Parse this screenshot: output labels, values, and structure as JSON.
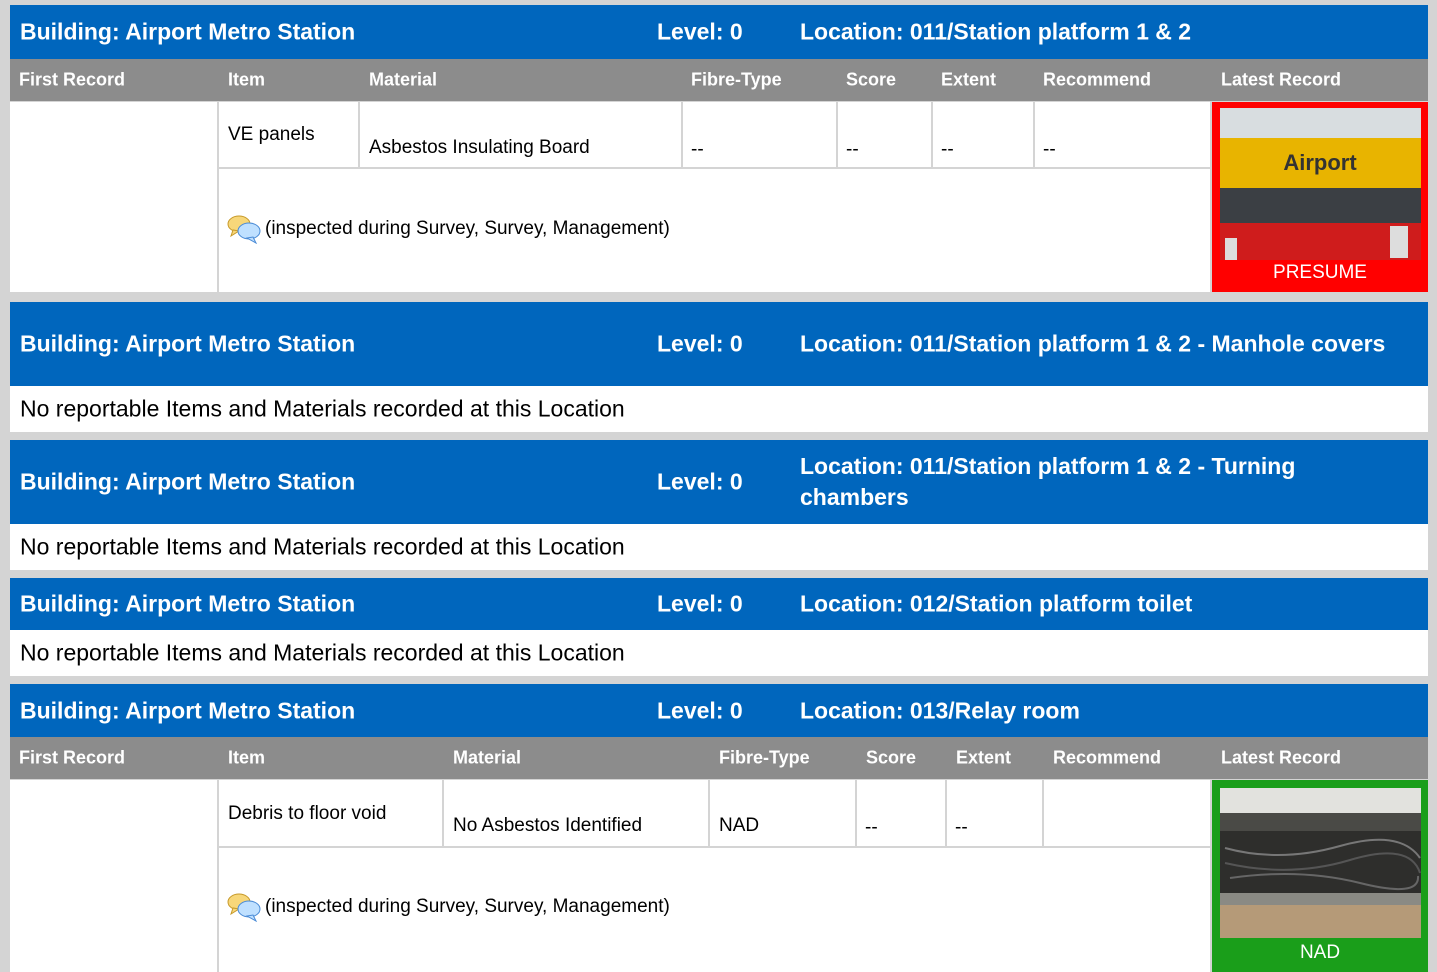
{
  "sections": [
    {
      "building": "Building: Airport Metro Station",
      "level": "Level: 0",
      "location": "Location: 011/Station platform 1 & 2"
    },
    {
      "building": "Building: Airport Metro Station",
      "level": "Level: 0",
      "location": "Location: 011/Station platform 1 & 2 - Manhole covers",
      "message": "No reportable Items and Materials recorded at this Location"
    },
    {
      "building": "Building: Airport Metro Station",
      "level": "Level: 0",
      "location": "Location: 011/Station platform 1 & 2 - Turning chambers",
      "message": "No reportable Items and Materials recorded at this Location"
    },
    {
      "building": "Building: Airport Metro Station",
      "level": "Level: 0",
      "location": "Location: 012/Station platform toilet",
      "message": "No reportable Items and Materials recorded at this Location"
    },
    {
      "building": "Building: Airport Metro Station",
      "level": "Level: 0",
      "location": "Location: 013/Relay room"
    }
  ],
  "columns": [
    "First Record",
    "Item",
    "Material",
    "Fibre-Type",
    "Score",
    "Extent",
    "Recommend",
    "Latest Record"
  ],
  "records": [
    {
      "item": "VE panels",
      "material": "Asbestos Insulating Board",
      "fibre_type": "--",
      "score": "--",
      "extent": "--",
      "recommend": "--",
      "note": "(inspected during Survey, Survey, Management)",
      "status": "PRESUME",
      "status_color": "#ff0000",
      "photo_sign_text": "Airport"
    },
    {
      "item": "Debris to floor void",
      "material": "No Asbestos Identified",
      "fibre_type": "NAD",
      "score": "--",
      "extent": "--",
      "recommend": "",
      "note": "(inspected during Survey, Survey, Management)",
      "status": "NAD",
      "status_color": "#1a9e1a"
    }
  ]
}
